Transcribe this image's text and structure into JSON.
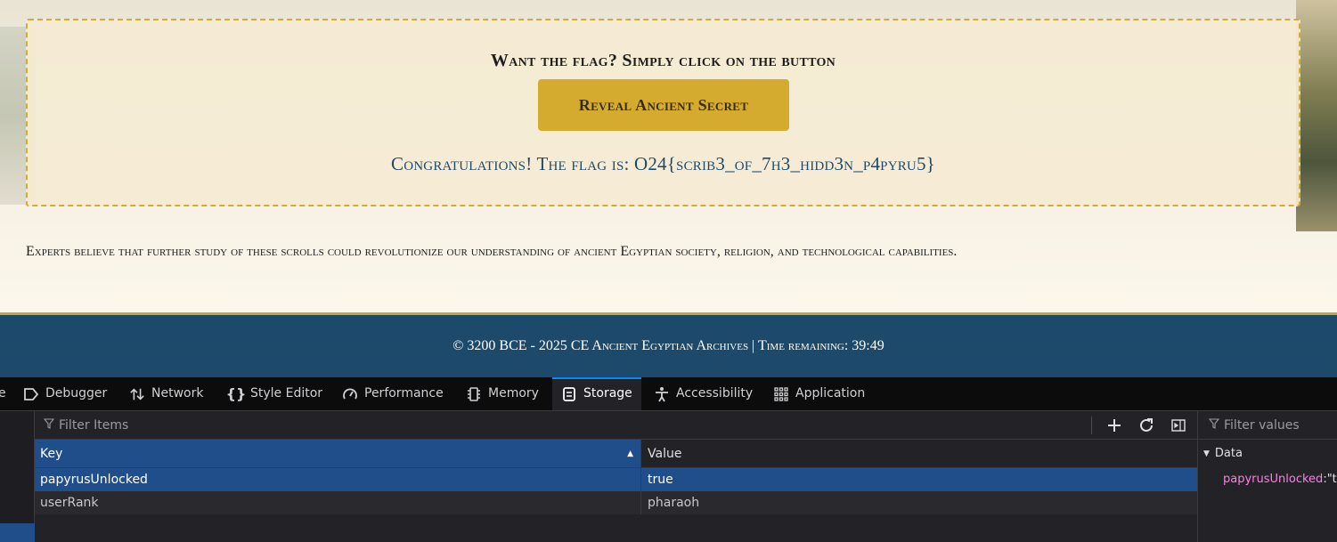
{
  "page": {
    "flag_prompt": "Want the flag? Simply click on the button",
    "reveal_button": "Reveal Ancient Secret",
    "flag_result": "Congratulations! The flag is: O24{scrib3_of_7h3_hidd3n_p4pyru5}",
    "experts_text": "Experts believe that further study of these scrolls could revolutionize our understanding of ancient Egyptian society, religion, and technological capabilities."
  },
  "footer": {
    "text": "© 3200 BCE - 2025 CE Ancient Egyptian Archives | Time remaining: 39:49"
  },
  "devtools": {
    "tabs": [
      {
        "label": "e",
        "icon": ""
      },
      {
        "label": "Debugger",
        "icon": "debugger-icon"
      },
      {
        "label": "Network",
        "icon": "network-icon"
      },
      {
        "label": "Style Editor",
        "icon": "style-editor-icon"
      },
      {
        "label": "Performance",
        "icon": "performance-icon"
      },
      {
        "label": "Memory",
        "icon": "memory-icon"
      },
      {
        "label": "Storage",
        "icon": "storage-icon",
        "selected": true
      },
      {
        "label": "Accessibility",
        "icon": "accessibility-icon"
      },
      {
        "label": "Application",
        "icon": "application-icon"
      }
    ],
    "filter_placeholder": "Filter Items",
    "columns": {
      "key": "Key",
      "value": "Value"
    },
    "rows": [
      {
        "key": "papyrusUnlocked",
        "value": "true"
      },
      {
        "key": "userRank",
        "value": "pharaoh"
      }
    ],
    "sidebar": {
      "filter_placeholder": "Filter values",
      "section": "Data",
      "item_key": "papyrusUnlocked",
      "item_value": ":\"t"
    },
    "colors": {
      "selected": "#204e8a",
      "accent": "#0a84ff",
      "key_highlight": "#ff7de9"
    }
  }
}
